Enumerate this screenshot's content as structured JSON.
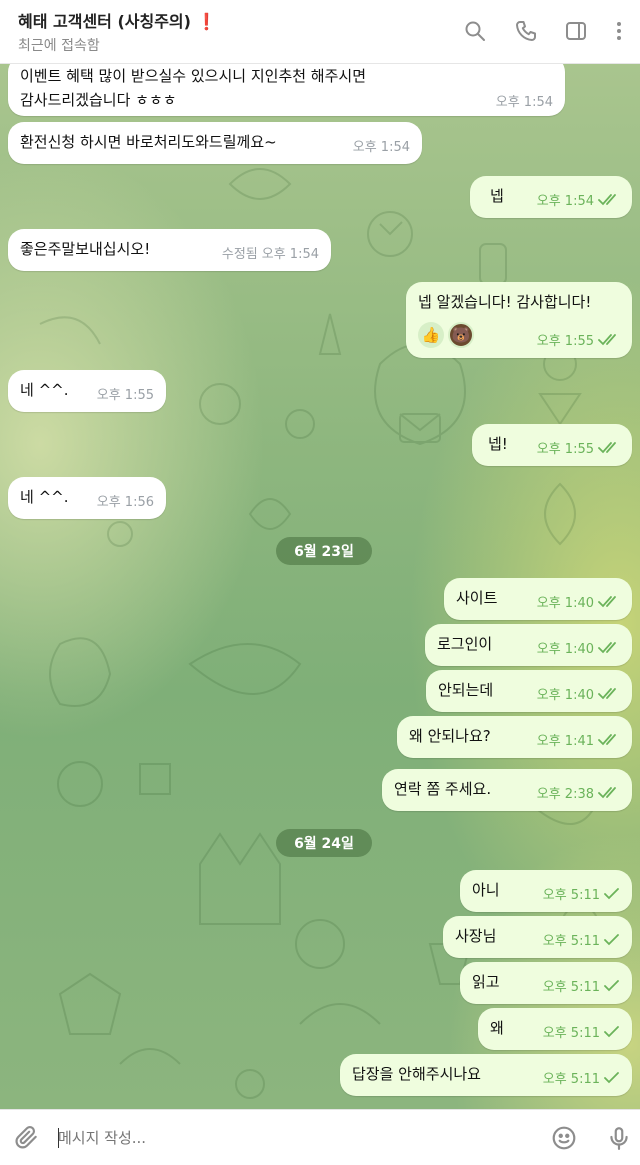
{
  "header": {
    "title": "혜태 고객센터 (사칭주의)",
    "title_mark": "❗",
    "subtitle": "최근에 접속함"
  },
  "colors": {
    "incoming_bubble": "#ffffff",
    "outgoing_bubble": "#effdde",
    "outgoing_meta": "#6bb35a",
    "incoming_meta": "#9aa0a6"
  },
  "icons": {
    "search": "search-icon",
    "call": "phone-icon",
    "sidebar": "sidebar-panel-icon",
    "more": "more-vertical-icon",
    "attach": "paperclip-icon",
    "emoji": "smiley-icon",
    "voice": "microphone-icon"
  },
  "dates": {
    "d1": "6월 23일",
    "d2": "6월 24일"
  },
  "messages": {
    "m1": {
      "text": "이벤트 혜택 많이 받으실수 있으시니 지인추천 해주시면\n감사드리겠습니다 ㅎㅎㅎ",
      "time": "오후 1:54"
    },
    "m2": {
      "text": "환전신청 하시면 바로처리도와드릴께요~",
      "time": "오후 1:54"
    },
    "m3": {
      "text": "넵",
      "time": "오후 1:54"
    },
    "m4": {
      "text": "좋은주말보내십시오!",
      "edited": "수정됨",
      "time": "오후 1:54"
    },
    "m5": {
      "text": "넵 알겠습니다! 감사합니다!",
      "time": "오후 1:55",
      "reactions": [
        "👍",
        "🐻"
      ]
    },
    "m6": {
      "text": "네 ^^.",
      "time": "오후 1:55"
    },
    "m7": {
      "text": "넵!",
      "time": "오후 1:55"
    },
    "m8": {
      "text": "네 ^^.",
      "time": "오후 1:56"
    },
    "m9": {
      "text": "사이트",
      "time": "오후 1:40"
    },
    "m10": {
      "text": "로그인이",
      "time": "오후 1:40"
    },
    "m11": {
      "text": "안되는데",
      "time": "오후 1:40"
    },
    "m12": {
      "text": "왜 안되나요?",
      "time": "오후 1:41"
    },
    "m13": {
      "text": "연락 쫌 주세요.",
      "time": "오후 2:38"
    },
    "m14": {
      "text": "아니",
      "time": "오후 5:11"
    },
    "m15": {
      "text": "사장님",
      "time": "오후 5:11"
    },
    "m16": {
      "text": "읽고",
      "time": "오후 5:11"
    },
    "m17": {
      "text": "왜",
      "time": "오후 5:11"
    },
    "m18": {
      "text": "답장을 안해주시나요",
      "time": "오후 5:11"
    }
  },
  "composer": {
    "placeholder": "메시지 작성..."
  }
}
